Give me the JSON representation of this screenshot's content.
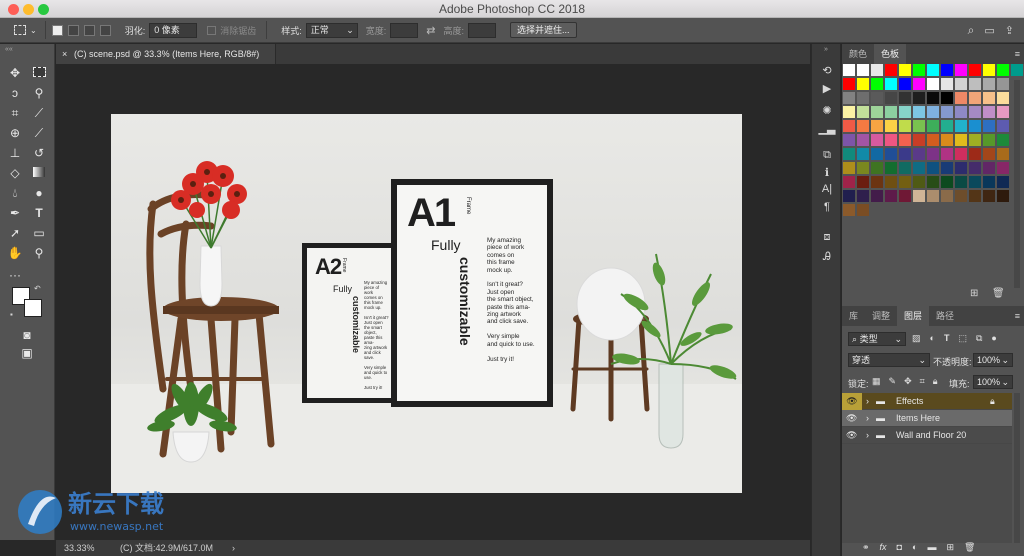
{
  "app": {
    "title": "Adobe Photoshop CC 2018",
    "traffic_colors": [
      "#fe5f57",
      "#febc2e",
      "#28c840"
    ]
  },
  "options_bar": {
    "feather_label": "羽化:",
    "feather_value": "0 像素",
    "antialias_label": "消除锯齿",
    "style_label": "样式:",
    "style_value": "正常",
    "width_label": "宽度:",
    "height_label": "高度:",
    "select_mask_button": "选择并遮住..."
  },
  "document_tab": {
    "label": "(C) scene.psd @ 33.3% (Items Here, RGB/8#)"
  },
  "artwork": {
    "frame_a2": {
      "title": "A2",
      "kicker": "Frame",
      "fully": "Fully",
      "vertical": "customizable",
      "body": [
        "My amazing",
        "piece of work",
        "comes on",
        "this frame",
        "mock up.",
        "",
        "Isn't it great?",
        "Just open",
        "the smart object,",
        "paste this ama-",
        "zing artwork",
        "and click save.",
        "",
        "Very simple",
        "and quick to use.",
        "",
        "Just try it!"
      ]
    },
    "frame_a1": {
      "title": "A1",
      "kicker": "Frame",
      "fully": "Fully",
      "vertical": "customizable",
      "body": [
        "My amazing",
        "piece of work",
        "comes on",
        "this frame",
        "mock up.",
        "",
        "Isn't it great?",
        "Just open",
        "the smart object,",
        "paste this ama-",
        "zing artwork",
        "and click save.",
        "",
        "Very simple",
        "and quick to use.",
        "",
        "Just try it!"
      ]
    }
  },
  "status_bar": {
    "zoom": "33.33%",
    "doc_info": "(C) 文档:42.9M/617.0M"
  },
  "panels": {
    "color_tabs": [
      "颜色",
      "色板"
    ],
    "layer_tabs": [
      "库",
      "调整",
      "图层",
      "路径"
    ],
    "filter_kind": "类型",
    "blend_mode": "穿透",
    "opacity_label": "不透明度:",
    "opacity_value": "100%",
    "lock_label": "锁定:",
    "fill_label": "填充:",
    "fill_value": "100%",
    "layers": [
      {
        "name": "Effects",
        "locked": true
      },
      {
        "name": "Items Here",
        "locked": false
      },
      {
        "name": "Wall and Floor 20",
        "locked": false
      }
    ]
  },
  "swatch_rows": [
    [
      "#ffffff",
      "#ffffff",
      "#e8e8e8",
      "#ff0000",
      "#ffff00",
      "#00ff00",
      "#00ffff",
      "#0000ff",
      "#ff00ff",
      "#ff0000",
      "#ffff00",
      "#00ff00",
      "#009c8c"
    ],
    [
      "#ff0000",
      "#ffff00",
      "#00ff00",
      "#00ffff",
      "#0000ff",
      "#ff00ff",
      "#ffffff",
      "#e6e6e6",
      "#d2d2d2",
      "#bebebe",
      "#aaaaaa",
      "#969696"
    ],
    [
      "#828282",
      "#6e6e6e",
      "#5a5a5a",
      "#464646",
      "#323232",
      "#1e1e1e",
      "#0a0a0a",
      "#000000",
      "#ee8866",
      "#f2a578",
      "#f6c08a",
      "#fbdd9c"
    ],
    [
      "#fbf3a4",
      "#c3e09a",
      "#9ed399",
      "#8ccfa0",
      "#86d3c9",
      "#7dc6e3",
      "#7fb1df",
      "#8499cf",
      "#8e89c5",
      "#a58ac3",
      "#c08ec8",
      "#e79ac3"
    ],
    [
      "#ef5a46",
      "#f47a42",
      "#f7a443",
      "#fbd146",
      "#c0dc4b",
      "#79c14f",
      "#3dae5a",
      "#23ae8f",
      "#21b2cb",
      "#1a8fd0",
      "#2e6fc2",
      "#5d5bb0"
    ],
    [
      "#7d55a8",
      "#a255a4",
      "#d65a9f",
      "#ee5682",
      "#f2614f",
      "#c83d26",
      "#d35d1f",
      "#da8b1c",
      "#e0bc1c",
      "#9fae23",
      "#57982a",
      "#1d8a3a"
    ],
    [
      "#128a7c",
      "#118aa7",
      "#1269a3",
      "#204e97",
      "#3b3a8a",
      "#5a3a89",
      "#7d3387",
      "#b03384",
      "#cf2e5e",
      "#9d2a18",
      "#a3461a",
      "#a86b1b"
    ],
    [
      "#ad8e1b",
      "#7a871f",
      "#3f7422",
      "#136d2f",
      "#116b62",
      "#0f6c84",
      "#0f5180",
      "#193b76",
      "#2d2c6d",
      "#452c6b",
      "#612766",
      "#872767"
    ],
    [
      "#9f2349",
      "#6b1d10",
      "#6c3412",
      "#6f4f12",
      "#735f12",
      "#4f5a15",
      "#284d17",
      "#0d4a1f",
      "#0b4a44",
      "#0a495c",
      "#0a375a",
      "#102954"
    ],
    [
      "#201f4e",
      "#2f1f4d",
      "#431c4a",
      "#5e1b4a",
      "#6f1835",
      "#cfb496",
      "#ab8d6d",
      "#8a6b4a",
      "#6d4d2b",
      "#533517",
      "#3f2612",
      "#2e1a0c"
    ],
    [
      "#8b5a2b",
      "#7a4d24"
    ]
  ]
}
